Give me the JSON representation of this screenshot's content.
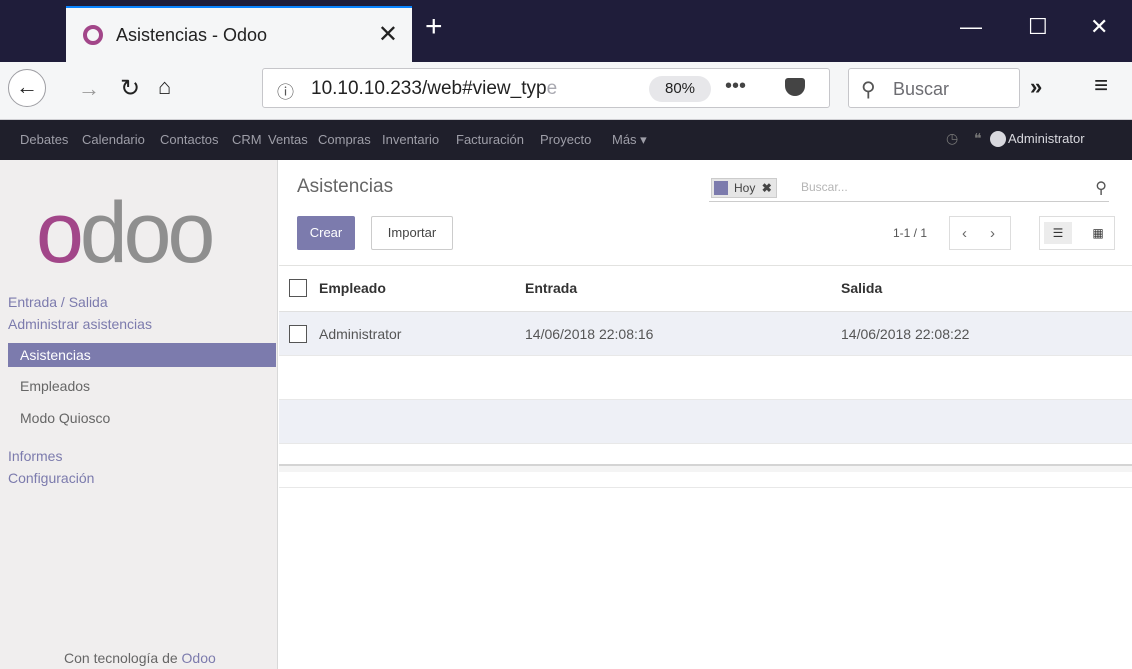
{
  "browser": {
    "tab_title": "Asistencias - Odoo",
    "url_host": "10.10.10.233/web#view_typ",
    "url_faded": "e",
    "zoom": "80%",
    "url_more": "•••",
    "search_placeholder": "Buscar"
  },
  "odoo_menu": {
    "items": [
      "Debates",
      "Calendario",
      "Contactos",
      "CRM",
      "Ventas",
      "Compras",
      "Inventario",
      "Facturación",
      "Proyecto",
      "Más ▾"
    ],
    "user": "Administrator"
  },
  "sidebar": {
    "logo": {
      "first": "o",
      "rest": "doo"
    },
    "sections": [
      "Entrada / Salida",
      "Administrar asistencias"
    ],
    "items": [
      "Asistencias",
      "Empleados",
      "Modo Quiosco"
    ],
    "bottom_sections": [
      "Informes",
      "Configuración"
    ],
    "powered_prefix": "Con tecnología de ",
    "powered_brand": "Odoo"
  },
  "control_panel": {
    "breadcrumb": "Asistencias",
    "create_label": "Crear",
    "import_label": "Importar",
    "facet_label": "Hoy",
    "facet_remove": "✖",
    "search_placeholder": "Buscar...",
    "pager": "1-1 / 1"
  },
  "table": {
    "headers": [
      "Empleado",
      "Entrada",
      "Salida"
    ],
    "rows": [
      [
        "Administrator",
        "14/06/2018 22:08:16",
        "14/06/2018 22:08:22"
      ]
    ]
  },
  "colors": {
    "odoo_purple": "#7c7bad",
    "odoo_brand": "#a24689",
    "browser_titlebar": "#1f1d3a"
  }
}
